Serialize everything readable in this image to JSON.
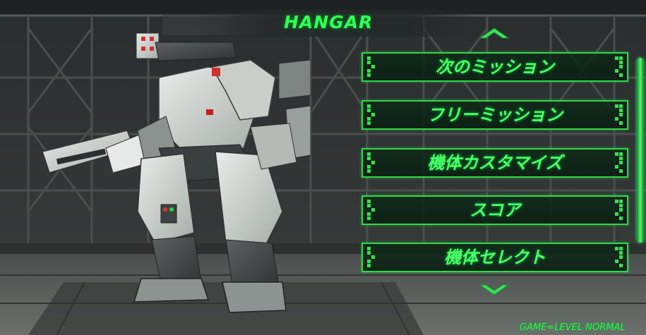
{
  "header": {
    "title": "HANGAR"
  },
  "menu": {
    "items": [
      {
        "label": "次のミッション"
      },
      {
        "label": "フリーミッション"
      },
      {
        "label": "機体カスタマイズ"
      },
      {
        "label": "スコア"
      },
      {
        "label": "機体セレクト"
      }
    ]
  },
  "footer": {
    "game_level": "GAME=LEVEL NORMAL"
  },
  "icons": {
    "scroll_up": "chevron-up-icon",
    "scroll_down": "chevron-down-icon"
  },
  "colors": {
    "accent": "#33ff55",
    "frame": "#2fd84a",
    "panel": "#0a2814"
  }
}
